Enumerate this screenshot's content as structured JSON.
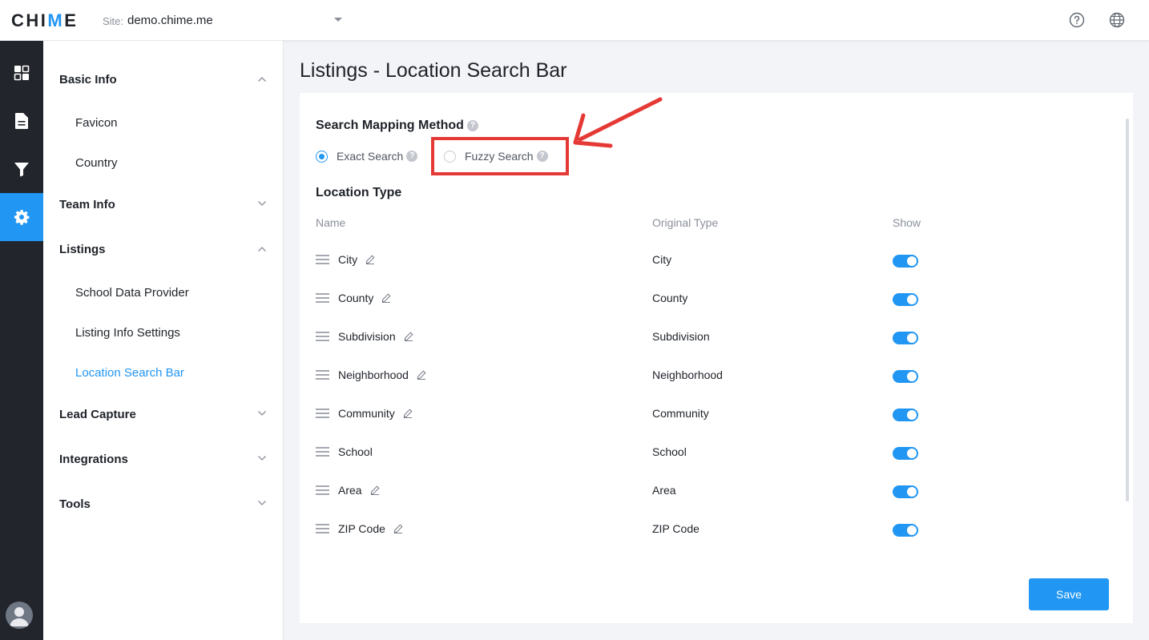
{
  "header": {
    "logo_text_start": "CHI",
    "logo_text_accent": "M",
    "logo_text_end": "E",
    "site_label": "Site:",
    "site_value": "demo.chime.me",
    "help_icon": "question-circle-icon",
    "language_icon": "globe-icon"
  },
  "rail": {
    "items": [
      {
        "icon": "dashboard-icon",
        "active": false
      },
      {
        "icon": "document-icon",
        "active": false
      },
      {
        "icon": "filter-icon",
        "active": false
      },
      {
        "icon": "gear-icon",
        "active": true
      }
    ],
    "avatar_icon": "user-avatar-icon"
  },
  "menu": {
    "groups": [
      {
        "label": "Basic Info",
        "expanded": true,
        "items": [
          "Favicon",
          "Country"
        ]
      },
      {
        "label": "Team Info",
        "expanded": false,
        "items": []
      },
      {
        "label": "Listings",
        "expanded": true,
        "items": [
          "School Data Provider",
          "Listing Info Settings",
          "Location Search Bar"
        ]
      },
      {
        "label": "Lead Capture",
        "expanded": false,
        "items": []
      },
      {
        "label": "Integrations",
        "expanded": false,
        "items": []
      },
      {
        "label": "Tools",
        "expanded": false,
        "items": []
      }
    ],
    "active_item": "Location Search Bar"
  },
  "page": {
    "title": "Listings - Location Search Bar",
    "mapping": {
      "title": "Search Mapping Method",
      "options": [
        {
          "label": "Exact Search",
          "checked": true
        },
        {
          "label": "Fuzzy Search",
          "checked": false
        }
      ],
      "help_glyph": "?"
    },
    "location_type": {
      "title": "Location Type",
      "columns": [
        "Name",
        "Original Type",
        "Show"
      ],
      "rows": [
        {
          "name": "City",
          "original": "City",
          "editable": true,
          "show": true
        },
        {
          "name": "County",
          "original": "County",
          "editable": true,
          "show": true
        },
        {
          "name": "Subdivision",
          "original": "Subdivision",
          "editable": true,
          "show": true
        },
        {
          "name": "Neighborhood",
          "original": "Neighborhood",
          "editable": true,
          "show": true
        },
        {
          "name": "Community",
          "original": "Community",
          "editable": true,
          "show": true
        },
        {
          "name": "School",
          "original": "School",
          "editable": false,
          "show": true
        },
        {
          "name": "Area",
          "original": "Area",
          "editable": true,
          "show": true
        },
        {
          "name": "ZIP Code",
          "original": "ZIP Code",
          "editable": true,
          "show": true
        }
      ]
    },
    "save_label": "Save"
  },
  "colors": {
    "accent": "#2196f3",
    "annotation": "#e53935",
    "rail_bg": "#22252b"
  }
}
